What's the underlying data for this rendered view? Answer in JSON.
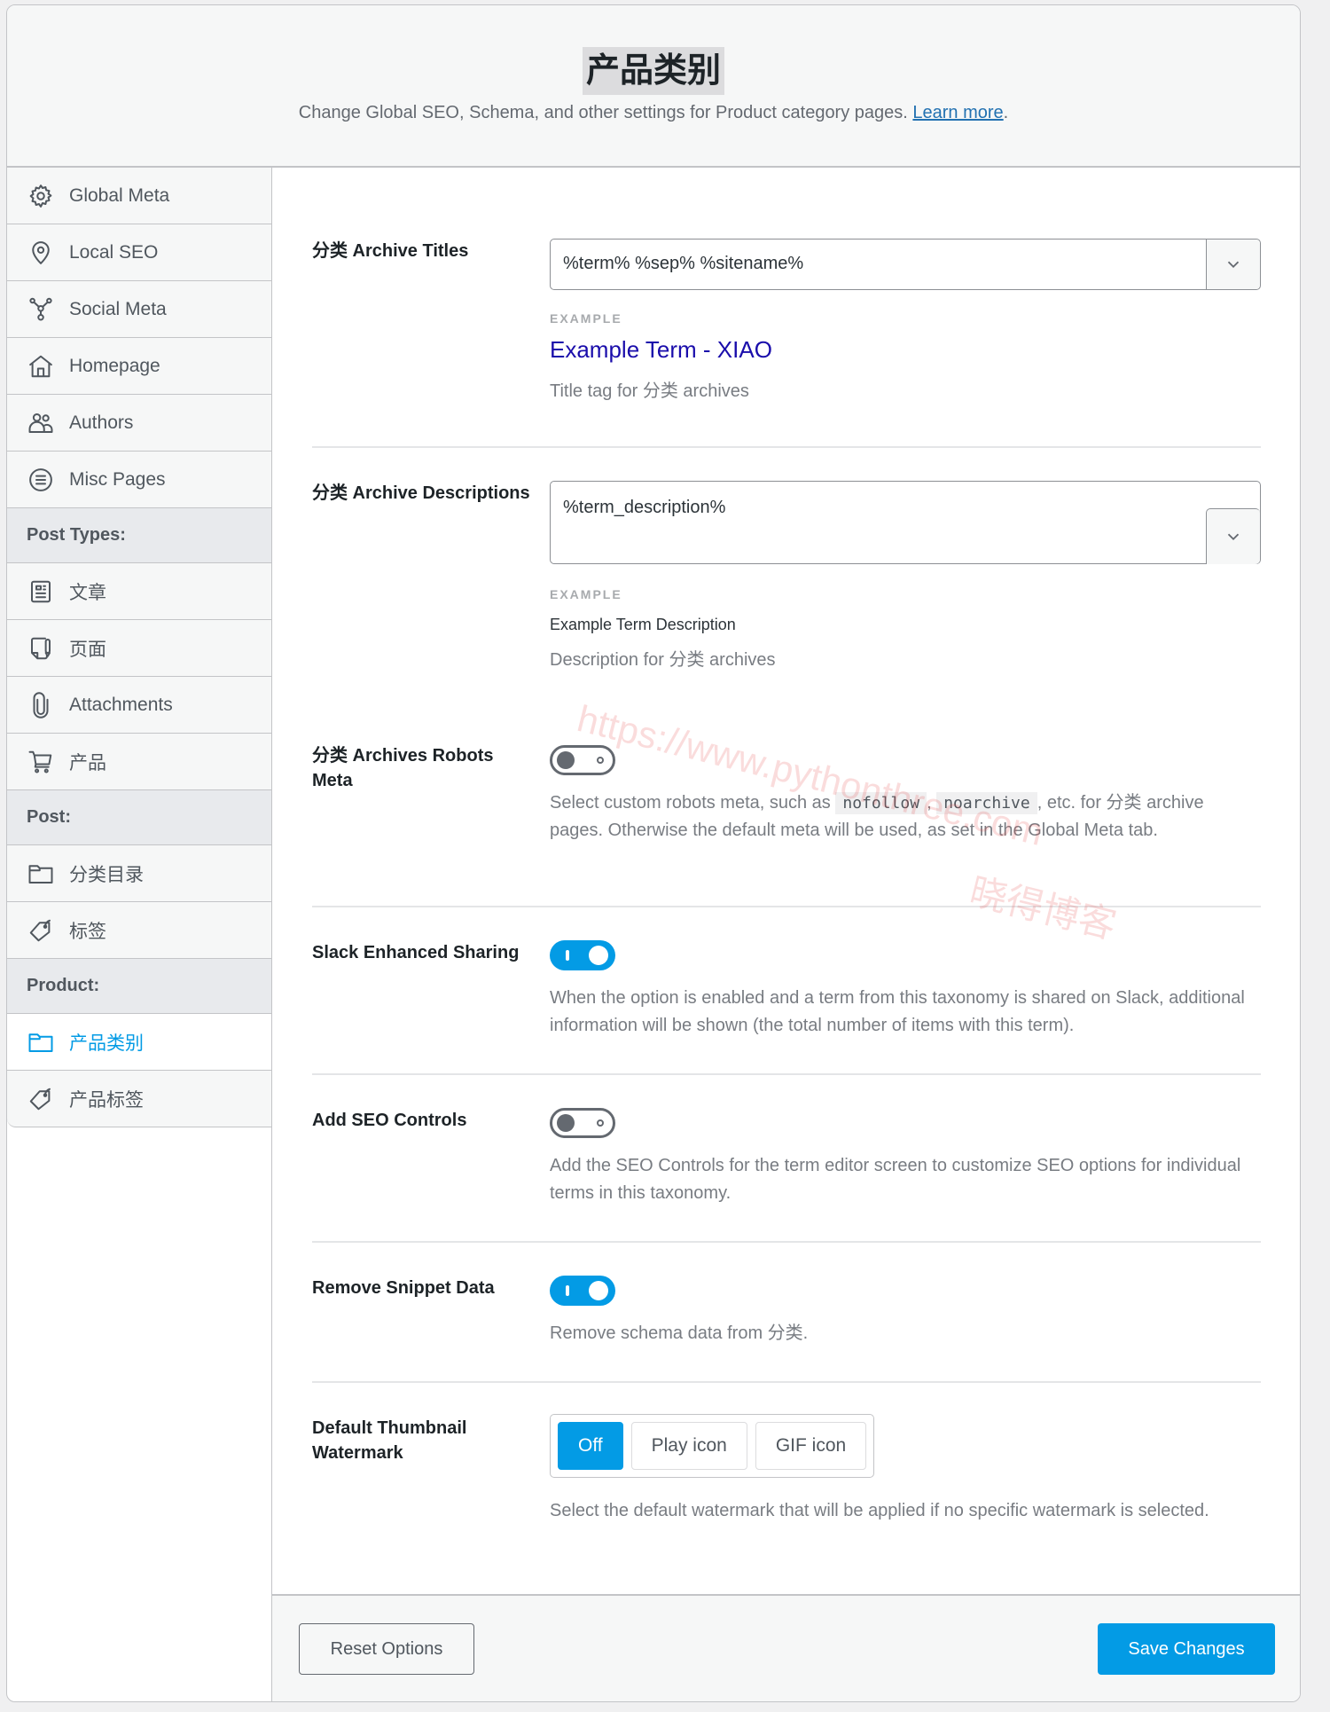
{
  "header": {
    "title": "产品类别",
    "subtitle": "Change Global SEO, Schema, and other settings for Product category pages.",
    "learn_more": "Learn more",
    "period": "."
  },
  "sidebar": {
    "items": [
      {
        "label": "Global Meta",
        "icon": "gear-icon"
      },
      {
        "label": "Local SEO",
        "icon": "location-pin-icon"
      },
      {
        "label": "Social Meta",
        "icon": "share-nodes-icon"
      },
      {
        "label": "Homepage",
        "icon": "home-icon"
      },
      {
        "label": "Authors",
        "icon": "users-icon"
      },
      {
        "label": "Misc Pages",
        "icon": "list-circle-icon"
      }
    ],
    "post_types_heading": "Post Types:",
    "post_types": [
      {
        "label": "文章",
        "icon": "document-icon"
      },
      {
        "label": "页面",
        "icon": "page-icon"
      },
      {
        "label": "Attachments",
        "icon": "paperclip-icon"
      },
      {
        "label": "产品",
        "icon": "cart-icon"
      }
    ],
    "post_heading": "Post:",
    "post": [
      {
        "label": "分类目录",
        "icon": "folder-icon"
      },
      {
        "label": "标签",
        "icon": "tag-icon"
      }
    ],
    "product_heading": "Product:",
    "product": [
      {
        "label": "产品类别",
        "icon": "folder-icon",
        "active": true
      },
      {
        "label": "产品标签",
        "icon": "tag-icon"
      }
    ]
  },
  "settings": {
    "archive_titles": {
      "label": "分类 Archive Titles",
      "value": "%term% %sep% %sitename%",
      "example_label": "EXAMPLE",
      "example": "Example Term - XIAO",
      "help": "Title tag for 分类 archives"
    },
    "archive_descriptions": {
      "label": "分类 Archive Descriptions",
      "value": "%term_description%",
      "example_label": "EXAMPLE",
      "example": "Example Term Description",
      "help": "Description for 分类 archives"
    },
    "robots_meta": {
      "label": "分类 Archives Robots Meta",
      "enabled": false,
      "help_before": "Select custom robots meta, such as ",
      "code1": "nofollow",
      "sep": ", ",
      "code2": "noarchive",
      "help_after": ", etc. for 分类 archive pages. Otherwise the default meta will be used, as set in the Global Meta tab."
    },
    "slack_sharing": {
      "label": "Slack Enhanced Sharing",
      "enabled": true,
      "help": "When the option is enabled and a term from this taxonomy is shared on Slack, additional information will be shown (the total number of items with this term)."
    },
    "seo_controls": {
      "label": "Add SEO Controls",
      "enabled": false,
      "help": "Add the SEO Controls for the term editor screen to customize SEO options for individual terms in this taxonomy."
    },
    "remove_snippet": {
      "label": "Remove Snippet Data",
      "enabled": true,
      "help": "Remove schema data from 分类."
    },
    "thumbnail_watermark": {
      "label": "Default Thumbnail Watermark",
      "options": [
        "Off",
        "Play icon",
        "GIF icon"
      ],
      "selected": "Off",
      "help": "Select the default watermark that will be applied if no specific watermark is selected."
    }
  },
  "footer": {
    "reset_label": "Reset Options",
    "save_label": "Save Changes"
  },
  "watermark": {
    "url": "https://www.pythonthree.com",
    "name": "晓得博客"
  },
  "colors": {
    "accent": "#039be5",
    "link": "#2271b1",
    "example_title": "#1a0dab"
  }
}
